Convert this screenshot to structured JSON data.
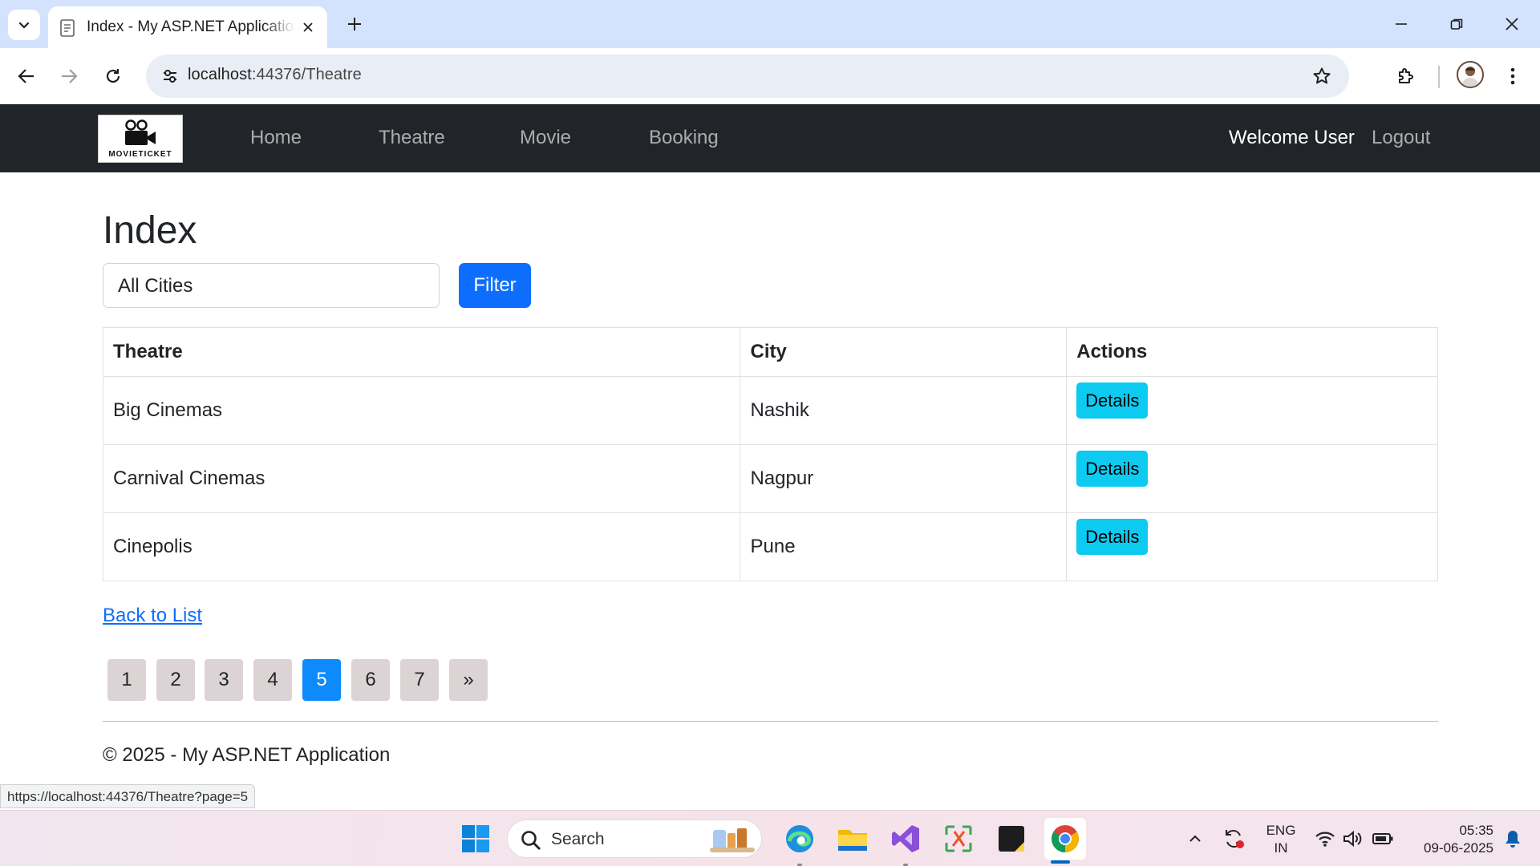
{
  "browser": {
    "tab_title": "Index - My ASP.NET Application",
    "url_host": "localhost",
    "url_path": ":44376/Theatre",
    "status_url": "https://localhost:44376/Theatre?page=5"
  },
  "navbar": {
    "brand_text": "MOVIETICKET",
    "links": [
      "Home",
      "Theatre",
      "Movie",
      "Booking"
    ],
    "welcome": "Welcome User",
    "logout": "Logout"
  },
  "page": {
    "title": "Index",
    "city_select_value": "All Cities",
    "filter_label": "Filter"
  },
  "table": {
    "headers": [
      "Theatre",
      "City",
      "Actions"
    ],
    "rows": [
      {
        "theatre": "Big Cinemas",
        "city": "Nashik",
        "action": "Details"
      },
      {
        "theatre": "Carnival Cinemas",
        "city": "Nagpur",
        "action": "Details"
      },
      {
        "theatre": "Cinepolis",
        "city": "Pune",
        "action": "Details"
      }
    ]
  },
  "back_link": "Back to List",
  "pagination": {
    "pages": [
      "1",
      "2",
      "3",
      "4",
      "5",
      "6",
      "7",
      "»"
    ],
    "current": "5"
  },
  "footer": "© 2025 - My ASP.NET Application",
  "taskbar": {
    "search_placeholder": "Search",
    "lang_line1": "ENG",
    "lang_line2": "IN",
    "time": "05:35",
    "date": "09-06-2025"
  },
  "colors": {
    "navbar_bg": "#212529",
    "primary": "#0d6efd",
    "info": "#0dcaf0",
    "page_active": "#0d8bfd",
    "page_inactive": "#dcd3d5"
  }
}
